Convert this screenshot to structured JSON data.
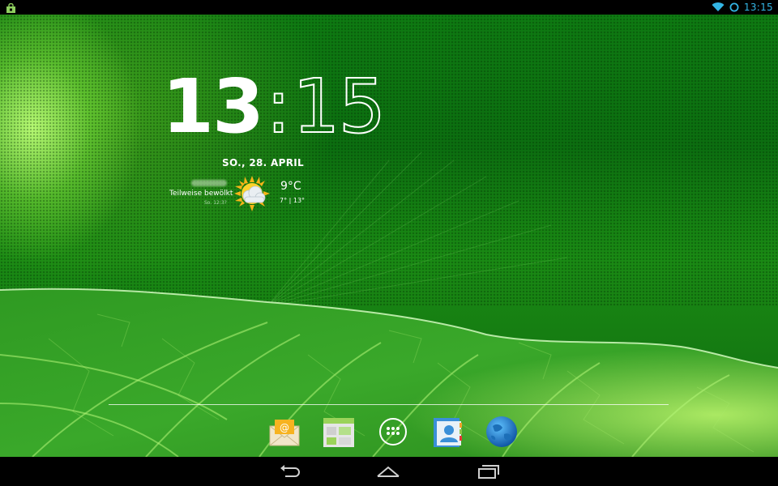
{
  "status_bar": {
    "time": "13:15",
    "notification_icon": "shopping-bag-icon",
    "wifi_icon": "wifi-icon",
    "sync_icon": "circle-status-icon",
    "accent_color": "#33b5e5"
  },
  "clock_widget": {
    "hours": "13",
    "separator": ":",
    "minutes": "15",
    "date": "SO., 28. APRIL"
  },
  "weather_widget": {
    "condition": "Teilweise bewölkt",
    "updated": "So. 12:3?",
    "temperature": "9°C",
    "range": "7° | 13°",
    "icon": "partly-cloudy-icon"
  },
  "dock": {
    "apps": [
      {
        "name": "email",
        "icon": "email-app-icon"
      },
      {
        "name": "gallery",
        "icon": "gallery-app-icon"
      },
      {
        "name": "all-apps",
        "icon": "app-drawer-icon"
      },
      {
        "name": "contacts",
        "icon": "contacts-app-icon"
      },
      {
        "name": "browser",
        "icon": "globe-browser-icon"
      }
    ]
  },
  "nav_bar": {
    "back": "back-icon",
    "home": "home-icon",
    "recents": "recent-apps-icon"
  }
}
